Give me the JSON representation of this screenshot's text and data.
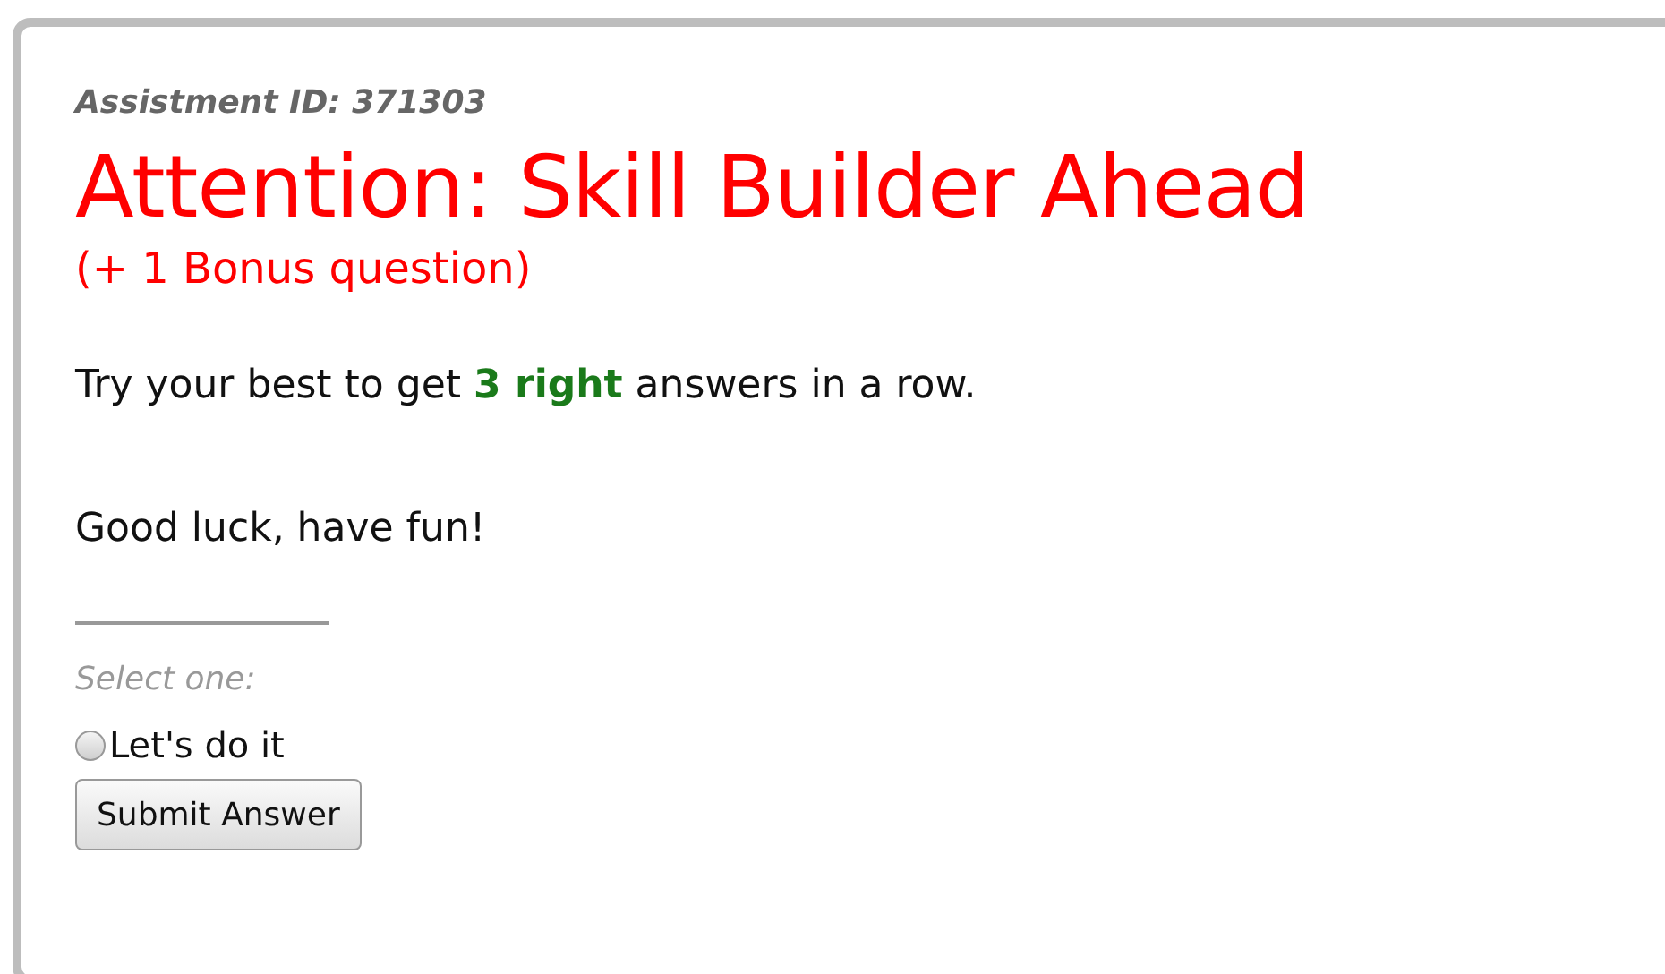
{
  "assistment_id": "Assistment ID: 371303",
  "title": "Attention: Skill Builder Ahead",
  "subtitle": "(+ 1 Bonus question)",
  "paragraphs": [
    "Try your best to get **3 right** answers in a row.",
    "Good luck, have fun!"
  ],
  "prompt": "Select one:",
  "options": [
    {
      "label": "Let's do it",
      "selected": false
    }
  ],
  "submit": "Submit Answer"
}
